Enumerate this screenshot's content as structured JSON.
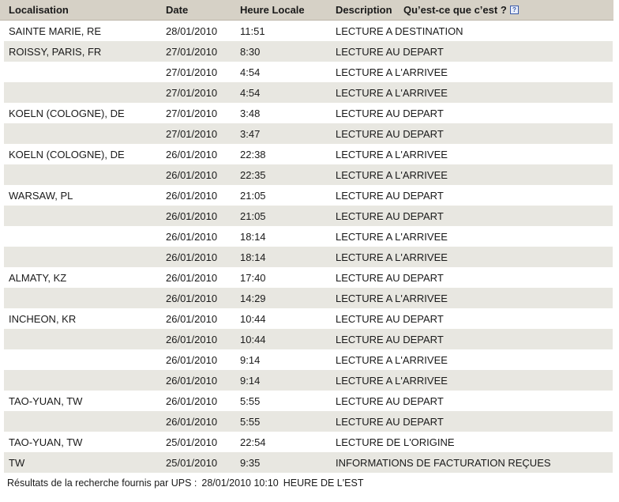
{
  "header": {
    "location": "Localisation",
    "date": "Date",
    "local_time": "Heure Locale",
    "description": "Description",
    "help_link": "Qu’est-ce que c’est ?",
    "help_icon": "?"
  },
  "rows": [
    {
      "location": "SAINTE MARIE, RE",
      "date": "28/01/2010",
      "time": "11:51",
      "description": "LECTURE A DESTINATION"
    },
    {
      "location": "ROISSY, PARIS, FR",
      "date": "27/01/2010",
      "time": "8:30",
      "description": "LECTURE AU DEPART"
    },
    {
      "location": "",
      "date": "27/01/2010",
      "time": "4:54",
      "description": "LECTURE A L'ARRIVEE"
    },
    {
      "location": "",
      "date": "27/01/2010",
      "time": "4:54",
      "description": "LECTURE A L'ARRIVEE"
    },
    {
      "location": "KOELN (COLOGNE), DE",
      "date": "27/01/2010",
      "time": "3:48",
      "description": "LECTURE AU DEPART"
    },
    {
      "location": "",
      "date": "27/01/2010",
      "time": "3:47",
      "description": "LECTURE AU DEPART"
    },
    {
      "location": "KOELN (COLOGNE), DE",
      "date": "26/01/2010",
      "time": "22:38",
      "description": "LECTURE A L'ARRIVEE"
    },
    {
      "location": "",
      "date": "26/01/2010",
      "time": "22:35",
      "description": "LECTURE A L'ARRIVEE"
    },
    {
      "location": "WARSAW, PL",
      "date": "26/01/2010",
      "time": "21:05",
      "description": "LECTURE AU DEPART"
    },
    {
      "location": "",
      "date": "26/01/2010",
      "time": "21:05",
      "description": "LECTURE AU DEPART"
    },
    {
      "location": "",
      "date": "26/01/2010",
      "time": "18:14",
      "description": "LECTURE A L'ARRIVEE"
    },
    {
      "location": "",
      "date": "26/01/2010",
      "time": "18:14",
      "description": "LECTURE A L'ARRIVEE"
    },
    {
      "location": "ALMATY, KZ",
      "date": "26/01/2010",
      "time": "17:40",
      "description": "LECTURE AU DEPART"
    },
    {
      "location": "",
      "date": "26/01/2010",
      "time": "14:29",
      "description": "LECTURE A L'ARRIVEE"
    },
    {
      "location": "INCHEON, KR",
      "date": "26/01/2010",
      "time": "10:44",
      "description": "LECTURE AU DEPART"
    },
    {
      "location": "",
      "date": "26/01/2010",
      "time": "10:44",
      "description": "LECTURE AU DEPART"
    },
    {
      "location": "",
      "date": "26/01/2010",
      "time": "9:14",
      "description": "LECTURE A L'ARRIVEE"
    },
    {
      "location": "",
      "date": "26/01/2010",
      "time": "9:14",
      "description": "LECTURE A L'ARRIVEE"
    },
    {
      "location": "TAO-YUAN, TW",
      "date": "26/01/2010",
      "time": "5:55",
      "description": "LECTURE AU DEPART"
    },
    {
      "location": "",
      "date": "26/01/2010",
      "time": "5:55",
      "description": "LECTURE AU DEPART"
    },
    {
      "location": "TAO-YUAN, TW",
      "date": "25/01/2010",
      "time": "22:54",
      "description": "LECTURE DE L'ORIGINE"
    },
    {
      "location": "TW",
      "date": "25/01/2010",
      "time": "9:35",
      "description": "INFORMATIONS DE FACTURATION REÇUES"
    }
  ],
  "footer": {
    "label": "Résultats de la recherche fournis par UPS :",
    "datetime": "28/01/2010 10:10",
    "timezone": "HEURE DE L'EST"
  },
  "colors": {
    "header_bg": "#d6d1c6",
    "row_alt_bg": "#e8e7e1",
    "row_bg": "#ffffff",
    "border": "#b8b1a6"
  }
}
